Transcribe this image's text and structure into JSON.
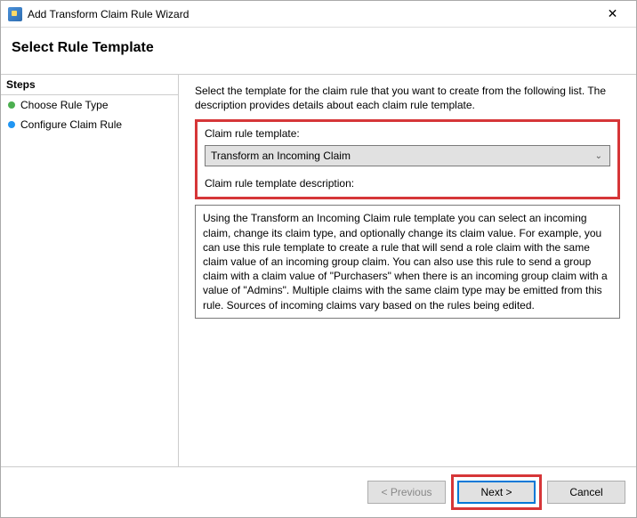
{
  "titlebar": {
    "title": "Add Transform Claim Rule Wizard",
    "close_glyph": "✕"
  },
  "heading": "Select Rule Template",
  "sidebar": {
    "header": "Steps",
    "items": [
      {
        "label": "Choose Rule Type",
        "bullet": "green"
      },
      {
        "label": "Configure Claim Rule",
        "bullet": "blue"
      }
    ]
  },
  "main": {
    "intro": "Select the template for the claim rule that you want to create from the following list. The description provides details about each claim rule template.",
    "template_label": "Claim rule template:",
    "template_selected": "Transform an Incoming Claim",
    "desc_label": "Claim rule template description:",
    "desc_text": "Using the Transform an Incoming Claim rule template you can select an incoming claim, change its claim type, and optionally change its claim value.  For example, you can use this rule template to create a rule that will send a role claim with the same claim value of an incoming group claim.  You can also use this rule to send a group claim with a claim value of \"Purchasers\" when there is an incoming group claim with a value of \"Admins\".  Multiple claims with the same claim type may be emitted from this rule.  Sources of incoming claims vary based on the rules being edited."
  },
  "buttons": {
    "previous": "< Previous",
    "next": "Next >",
    "cancel": "Cancel"
  }
}
